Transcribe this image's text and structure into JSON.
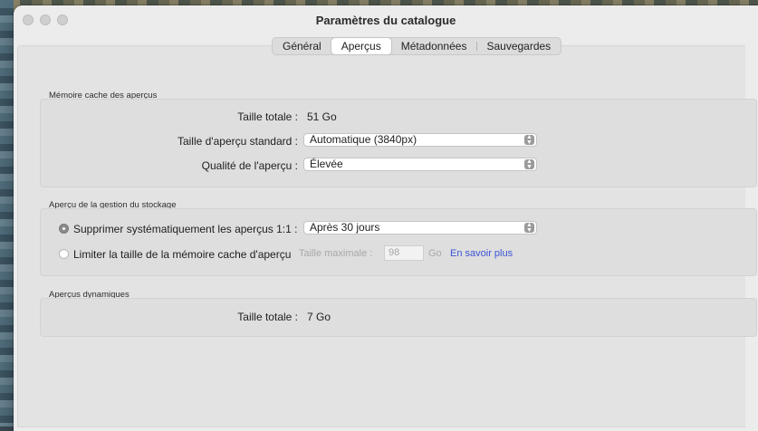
{
  "window": {
    "title": "Paramètres du catalogue"
  },
  "tabs": [
    {
      "label": "Général"
    },
    {
      "label": "Aperçus"
    },
    {
      "label": "Métadonnées"
    },
    {
      "label": "Sauvegardes"
    }
  ],
  "cache": {
    "section_label": "Mémoire cache des aperçus",
    "total_label": "Taille totale :",
    "total_value": "51 Go",
    "std_size_label": "Taille d'aperçu standard :",
    "std_size_value": "Automatique (3840px)",
    "quality_label": "Qualité de l'aperçu :",
    "quality_value": "Élevée"
  },
  "storage": {
    "section_label": "Aperçu de la gestion du stockage",
    "delete_label": "Supprimer systématiquement les aperçus 1:1 :",
    "delete_value": "Après 30 jours",
    "limit_label": "Limiter la taille de la mémoire cache d'aperçu",
    "max_label": "Taille maximale :",
    "max_value": "98",
    "unit": "Go",
    "learn_more": "En savoir plus"
  },
  "dynamic": {
    "section_label": "Aperçus dynamiques",
    "total_label": "Taille totale :",
    "total_value": "7 Go"
  }
}
